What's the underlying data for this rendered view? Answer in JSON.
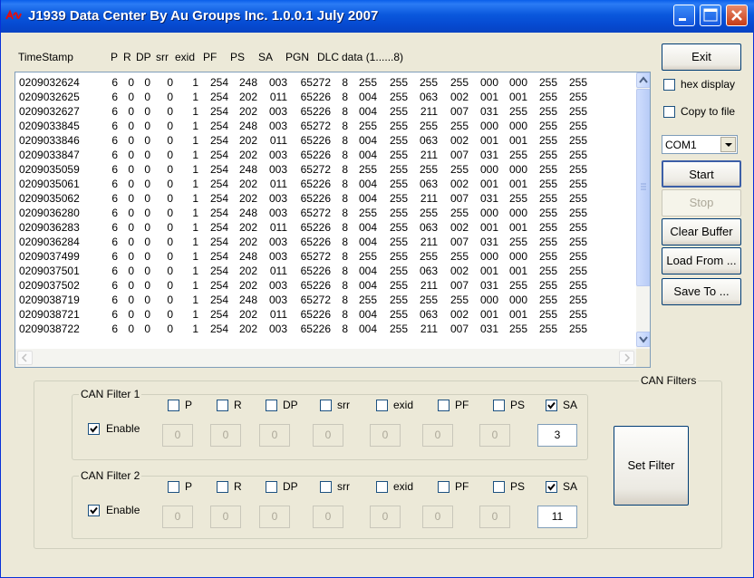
{
  "window": {
    "title": "J1939 Data Center By Au Groups Inc.  1.0.0.1  July 2007"
  },
  "log": {
    "headers": [
      "TimeStamp",
      "P",
      "R",
      "DP",
      "srr",
      "exid",
      "PF",
      "PS",
      "SA",
      "PGN",
      "DLC",
      "data (1......8)"
    ],
    "rows": [
      [
        "0209032624",
        "6",
        "0",
        "0",
        "0",
        "1",
        "254",
        "248",
        "003",
        "65272",
        "8",
        "255",
        "255",
        "255",
        "255",
        "000",
        "000",
        "255",
        "255"
      ],
      [
        "0209032625",
        "6",
        "0",
        "0",
        "0",
        "1",
        "254",
        "202",
        "011",
        "65226",
        "8",
        "004",
        "255",
        "063",
        "002",
        "001",
        "001",
        "255",
        "255"
      ],
      [
        "0209032627",
        "6",
        "0",
        "0",
        "0",
        "1",
        "254",
        "202",
        "003",
        "65226",
        "8",
        "004",
        "255",
        "211",
        "007",
        "031",
        "255",
        "255",
        "255"
      ],
      [
        "0209033845",
        "6",
        "0",
        "0",
        "0",
        "1",
        "254",
        "248",
        "003",
        "65272",
        "8",
        "255",
        "255",
        "255",
        "255",
        "000",
        "000",
        "255",
        "255"
      ],
      [
        "0209033846",
        "6",
        "0",
        "0",
        "0",
        "1",
        "254",
        "202",
        "011",
        "65226",
        "8",
        "004",
        "255",
        "063",
        "002",
        "001",
        "001",
        "255",
        "255"
      ],
      [
        "0209033847",
        "6",
        "0",
        "0",
        "0",
        "1",
        "254",
        "202",
        "003",
        "65226",
        "8",
        "004",
        "255",
        "211",
        "007",
        "031",
        "255",
        "255",
        "255"
      ],
      [
        "0209035059",
        "6",
        "0",
        "0",
        "0",
        "1",
        "254",
        "248",
        "003",
        "65272",
        "8",
        "255",
        "255",
        "255",
        "255",
        "000",
        "000",
        "255",
        "255"
      ],
      [
        "0209035061",
        "6",
        "0",
        "0",
        "0",
        "1",
        "254",
        "202",
        "011",
        "65226",
        "8",
        "004",
        "255",
        "063",
        "002",
        "001",
        "001",
        "255",
        "255"
      ],
      [
        "0209035062",
        "6",
        "0",
        "0",
        "0",
        "1",
        "254",
        "202",
        "003",
        "65226",
        "8",
        "004",
        "255",
        "211",
        "007",
        "031",
        "255",
        "255",
        "255"
      ],
      [
        "0209036280",
        "6",
        "0",
        "0",
        "0",
        "1",
        "254",
        "248",
        "003",
        "65272",
        "8",
        "255",
        "255",
        "255",
        "255",
        "000",
        "000",
        "255",
        "255"
      ],
      [
        "0209036283",
        "6",
        "0",
        "0",
        "0",
        "1",
        "254",
        "202",
        "011",
        "65226",
        "8",
        "004",
        "255",
        "063",
        "002",
        "001",
        "001",
        "255",
        "255"
      ],
      [
        "0209036284",
        "6",
        "0",
        "0",
        "0",
        "1",
        "254",
        "202",
        "003",
        "65226",
        "8",
        "004",
        "255",
        "211",
        "007",
        "031",
        "255",
        "255",
        "255"
      ],
      [
        "0209037499",
        "6",
        "0",
        "0",
        "0",
        "1",
        "254",
        "248",
        "003",
        "65272",
        "8",
        "255",
        "255",
        "255",
        "255",
        "000",
        "000",
        "255",
        "255"
      ],
      [
        "0209037501",
        "6",
        "0",
        "0",
        "0",
        "1",
        "254",
        "202",
        "011",
        "65226",
        "8",
        "004",
        "255",
        "063",
        "002",
        "001",
        "001",
        "255",
        "255"
      ],
      [
        "0209037502",
        "6",
        "0",
        "0",
        "0",
        "1",
        "254",
        "202",
        "003",
        "65226",
        "8",
        "004",
        "255",
        "211",
        "007",
        "031",
        "255",
        "255",
        "255"
      ],
      [
        "0209038719",
        "6",
        "0",
        "0",
        "0",
        "1",
        "254",
        "248",
        "003",
        "65272",
        "8",
        "255",
        "255",
        "255",
        "255",
        "000",
        "000",
        "255",
        "255"
      ],
      [
        "0209038721",
        "6",
        "0",
        "0",
        "0",
        "1",
        "254",
        "202",
        "011",
        "65226",
        "8",
        "004",
        "255",
        "063",
        "002",
        "001",
        "001",
        "255",
        "255"
      ],
      [
        "0209038722",
        "6",
        "0",
        "0",
        "0",
        "1",
        "254",
        "202",
        "003",
        "65226",
        "8",
        "004",
        "255",
        "211",
        "007",
        "031",
        "255",
        "255",
        "255"
      ]
    ]
  },
  "controls": {
    "exit": "Exit",
    "hex_display": {
      "label": "hex display",
      "checked": false
    },
    "copy_to_file": {
      "label": "Copy to file",
      "checked": false
    },
    "port": "COM1",
    "start": "Start",
    "stop": "Stop",
    "clear_buffer": "Clear Buffer",
    "load_from": "Load From ...",
    "save_to": "Save To ..."
  },
  "can_filters": {
    "title": "CAN Filters",
    "set_filter": "Set Filter",
    "filters": [
      {
        "title": "CAN Filter 1",
        "enable_label": "Enable",
        "enabled": true,
        "fields": [
          {
            "label": "P",
            "checked": false,
            "value": "0"
          },
          {
            "label": "R",
            "checked": false,
            "value": "0"
          },
          {
            "label": "DP",
            "checked": false,
            "value": "0"
          },
          {
            "label": "srr",
            "checked": false,
            "value": "0"
          },
          {
            "label": "exid",
            "checked": false,
            "value": "0"
          },
          {
            "label": "PF",
            "checked": false,
            "value": "0"
          },
          {
            "label": "PS",
            "checked": false,
            "value": "0"
          },
          {
            "label": "SA",
            "checked": true,
            "value": "3"
          }
        ]
      },
      {
        "title": "CAN Filter 2",
        "enable_label": "Enable",
        "enabled": true,
        "fields": [
          {
            "label": "P",
            "checked": false,
            "value": "0"
          },
          {
            "label": "R",
            "checked": false,
            "value": "0"
          },
          {
            "label": "DP",
            "checked": false,
            "value": "0"
          },
          {
            "label": "srr",
            "checked": false,
            "value": "0"
          },
          {
            "label": "exid",
            "checked": false,
            "value": "0"
          },
          {
            "label": "PF",
            "checked": false,
            "value": "0"
          },
          {
            "label": "PS",
            "checked": false,
            "value": "0"
          },
          {
            "label": "SA",
            "checked": true,
            "value": "11"
          }
        ]
      }
    ]
  }
}
